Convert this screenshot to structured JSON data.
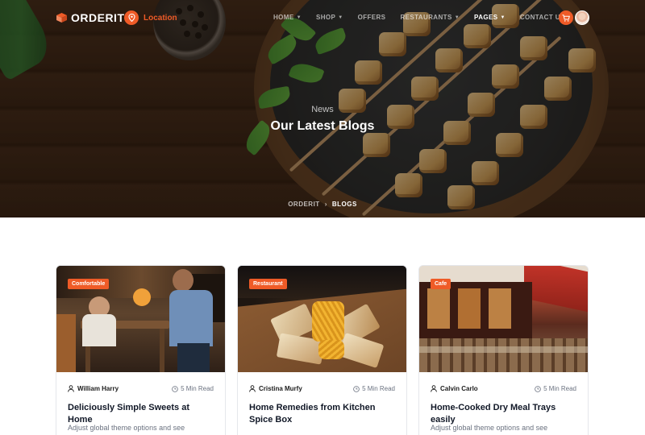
{
  "brand": {
    "name": "ORDERIT",
    "accent": "#ef5b27"
  },
  "nav": {
    "location_label": "Location",
    "items": [
      {
        "label": "HOME",
        "dropdown": true,
        "active": false
      },
      {
        "label": "SHOP",
        "dropdown": true,
        "active": false
      },
      {
        "label": "OFFERS",
        "dropdown": false,
        "active": false
      },
      {
        "label": "RESTAURANTS",
        "dropdown": true,
        "active": false
      },
      {
        "label": "PAGES",
        "dropdown": true,
        "active": true
      },
      {
        "label": "CONTACT US",
        "dropdown": false,
        "active": false
      }
    ],
    "cart_icon": "cart-icon",
    "avatar_icon": "user-avatar"
  },
  "hero": {
    "subtitle": "News",
    "title": "Our Latest Blogs",
    "breadcrumb": {
      "home": "ORDERIT",
      "separator": "›",
      "current": "BLOGS"
    }
  },
  "posts": [
    {
      "badge": "Comfortable",
      "author": "William Harry",
      "read_time": "5 Min Read",
      "title": "Deliciously Simple Sweets at Home",
      "excerpt": "Adjust global theme options and see"
    },
    {
      "badge": "Restaurant",
      "author": "Cristina Murfy",
      "read_time": "5 Min Read",
      "title": "Home Remedies from Kitchen Spice Box",
      "excerpt": ""
    },
    {
      "badge": "Cafe",
      "author": "Calvin Carlo",
      "read_time": "5 Min Read",
      "title": "Home-Cooked Dry Meal Trays easily",
      "excerpt": "Adjust global theme options and see"
    }
  ]
}
